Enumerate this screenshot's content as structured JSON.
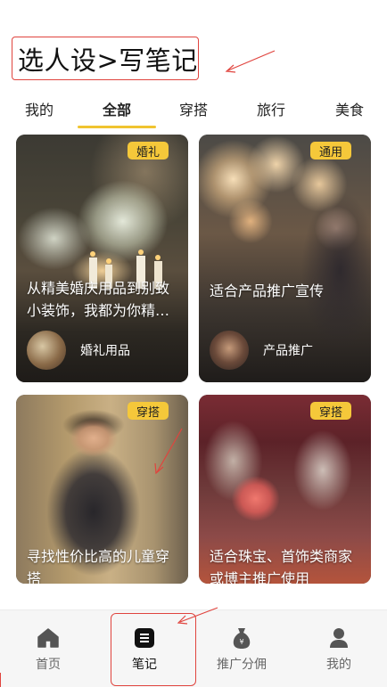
{
  "header": {
    "title": "选人设>写笔记"
  },
  "tabs": [
    {
      "label": "我的",
      "active": false
    },
    {
      "label": "全部",
      "active": true
    },
    {
      "label": "穿搭",
      "active": false
    },
    {
      "label": "旅行",
      "active": false
    },
    {
      "label": "美食",
      "active": false
    }
  ],
  "cards": [
    {
      "tag": "婚礼",
      "title": "从精美婚庆用品到别致小装饰，我都为你精…",
      "meta": "婚礼用品"
    },
    {
      "tag": "通用",
      "title": "适合产品推广宣传",
      "meta": "产品推广"
    },
    {
      "tag": "穿搭",
      "title": "寻找性价比高的儿童穿搭",
      "meta": ""
    },
    {
      "tag": "穿搭",
      "title": "适合珠宝、首饰类商家或博主推广使用",
      "meta": ""
    }
  ],
  "bottom_nav": [
    {
      "label": "首页",
      "icon": "home-icon",
      "active": false
    },
    {
      "label": "笔记",
      "icon": "note-icon",
      "active": true
    },
    {
      "label": "推广分佣",
      "icon": "money-bag-icon",
      "active": false
    },
    {
      "label": "我的",
      "icon": "user-icon",
      "active": false
    }
  ],
  "colors": {
    "accent": "#f0c430",
    "tag_bg": "#f5c83a",
    "annotation_red": "#e0443e",
    "nav_bg": "#f6f6f6"
  }
}
